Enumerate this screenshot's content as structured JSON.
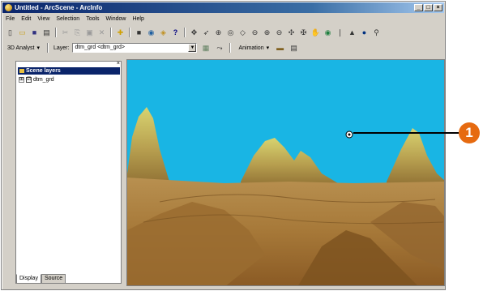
{
  "window": {
    "title": "Untitled - ArcScene - ArcInfo",
    "controls": [
      "_",
      "□",
      "×"
    ]
  },
  "menu": [
    "File",
    "Edit",
    "View",
    "Selection",
    "Tools",
    "Window",
    "Help"
  ],
  "toolbar1": {
    "icons": [
      "new-doc-icon",
      "open-icon",
      "save-icon",
      "print-icon",
      "cut-icon",
      "copy-icon",
      "paste-icon",
      "delete-icon",
      "add-data-icon",
      "fullscreen-icon",
      "globe-icon",
      "layer-icon",
      "whats-this-icon",
      "navigate-icon",
      "fly-icon",
      "center-target-icon",
      "zoom-target-icon",
      "set-observer-icon",
      "zoom-in-out-icon",
      "zoom-in-icon",
      "zoom-out-icon",
      "pan-icon",
      "full-extent-icon",
      "identify-icon",
      "select-icon",
      "info-icon",
      "find-icon"
    ],
    "glyphs": [
      "▯",
      "▭",
      "■",
      "▤",
      "✂",
      "⎘",
      "▣",
      "✕",
      "✚",
      "■",
      "◉",
      "◈",
      "?",
      "✥",
      "➶",
      "⊕",
      "◎",
      "◇",
      "⊖",
      "⊕",
      "⊖",
      "✣",
      "✠",
      "✋",
      "◉",
      "❘",
      "▲",
      "●",
      "⚲"
    ]
  },
  "toolbar2": {
    "analyst_label": "3D Analyst",
    "layer_label": "Layer:",
    "layer_value": "dtm_grd <dtm_grd>",
    "animation_label": "Animation"
  },
  "toc": {
    "header": "Scene layers",
    "layer_name": "dtm_grd",
    "expander": "⊞",
    "check": "☑",
    "tabs": [
      "Display",
      "Source"
    ]
  },
  "callout": {
    "number": "1",
    "color": "#e66a10"
  },
  "colors": {
    "sky": "#19b5e4",
    "terrain": "#a67838"
  }
}
